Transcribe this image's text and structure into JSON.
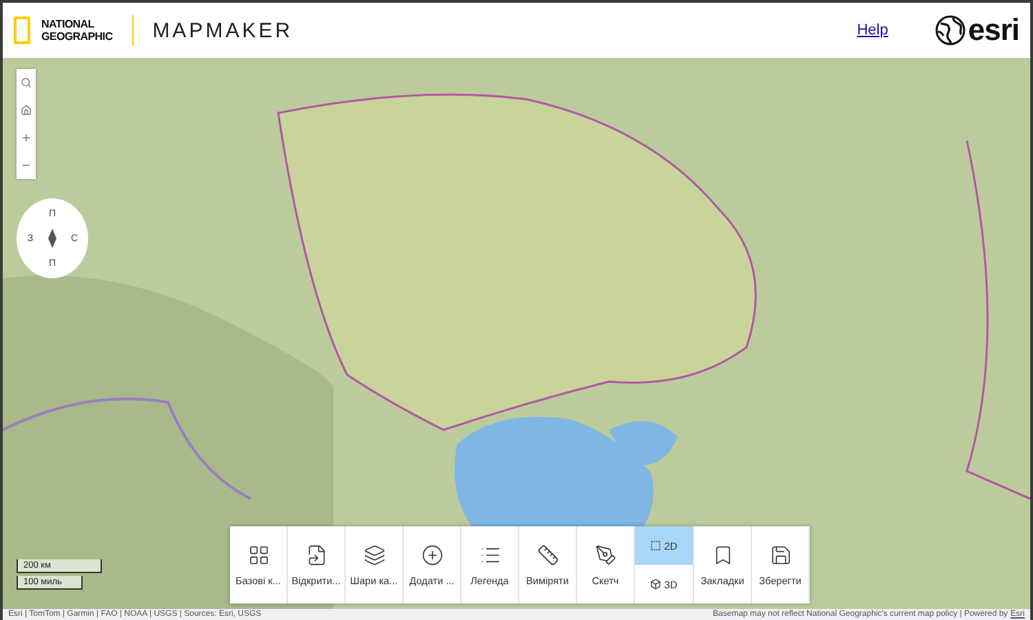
{
  "header": {
    "logo_lines": [
      "NATIONAL",
      "GEOGRAPHIC"
    ],
    "app_title": "MAPMAKER",
    "help_link": "Help",
    "brand": "esri"
  },
  "compass": {
    "north": "П",
    "west": "З",
    "east": "С",
    "south": "П"
  },
  "scale_bar": [
    "200 км",
    "100 миль"
  ],
  "toolbar": [
    {
      "kind": "tool",
      "label": "Базові к..."
    },
    {
      "kind": "tool",
      "label": "Відкрити..."
    },
    {
      "kind": "tool",
      "label": "Шари ка..."
    },
    {
      "kind": "tool",
      "label": "Додати ..."
    },
    {
      "kind": "tool",
      "label": "Легенда"
    },
    {
      "kind": "tool",
      "label": "Виміряти"
    },
    {
      "kind": "tool",
      "label": "Скетч"
    },
    {
      "kind": "view-toggle",
      "options": [
        {
          "label": "2D",
          "selected": true
        },
        {
          "label": "3D",
          "selected": false
        }
      ]
    },
    {
      "kind": "tool",
      "label": "Закладки"
    },
    {
      "kind": "tool",
      "label": "Зберегти"
    }
  ],
  "attribution": {
    "sources": "Esri | TomTom | Garmin | FAO | NOAA | USGS | Sources: Esri, USGS",
    "notice": "Basemap may not reflect National Geographic's current map policy | Powered by",
    "link": "Esri"
  }
}
